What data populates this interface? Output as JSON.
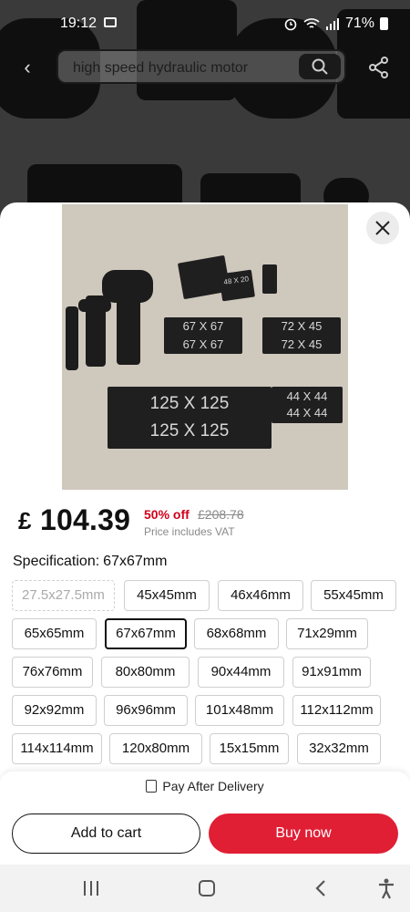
{
  "status_bar": {
    "time": "19:12",
    "battery": "71%"
  },
  "search": {
    "query": "high speed hydraulic motor"
  },
  "product": {
    "currency": "£",
    "price": "104.39",
    "discount": "50% off",
    "original_price": "£208.78",
    "vat_note": "Price includes VAT",
    "image_labels": [
      "67 X 67",
      "67 X 67",
      "72 X 45",
      "72 X 45",
      "125 X 125",
      "125 X 125",
      "44 X 44",
      "44 X 44",
      "48 X 20"
    ]
  },
  "specification": {
    "label": "Specification:",
    "selected": "67x67mm",
    "options": [
      {
        "label": "27.5x27.5mm",
        "state": "disabled"
      },
      {
        "label": "45x45mm",
        "state": "normal"
      },
      {
        "label": "46x46mm",
        "state": "normal"
      },
      {
        "label": "55x45mm",
        "state": "normal"
      },
      {
        "label": "65x65mm",
        "state": "normal"
      },
      {
        "label": "67x67mm",
        "state": "selected"
      },
      {
        "label": "68x68mm",
        "state": "normal"
      },
      {
        "label": "71x29mm",
        "state": "normal"
      },
      {
        "label": "76x76mm",
        "state": "normal"
      },
      {
        "label": "80x80mm",
        "state": "normal"
      },
      {
        "label": "90x44mm",
        "state": "normal"
      },
      {
        "label": "91x91mm",
        "state": "normal"
      },
      {
        "label": "92x92mm",
        "state": "normal"
      },
      {
        "label": "96x96mm",
        "state": "normal"
      },
      {
        "label": "101x48mm",
        "state": "normal"
      },
      {
        "label": "112x112mm",
        "state": "normal"
      },
      {
        "label": "114x114mm",
        "state": "normal"
      },
      {
        "label": "120x80mm",
        "state": "normal"
      },
      {
        "label": "15x15mm",
        "state": "normal"
      },
      {
        "label": "32x32mm",
        "state": "normal"
      }
    ]
  },
  "footer": {
    "pay_after": "Pay After Delivery",
    "add_to_cart": "Add to cart",
    "buy_now": "Buy now"
  },
  "colors": {
    "accent_red": "#e01f35",
    "discount_red": "#d0021b"
  },
  "icons": [
    "message-icon",
    "alarm-icon",
    "wifi-icon",
    "signal-icon",
    "battery-icon",
    "back-arrow-icon",
    "search-icon",
    "share-icon",
    "close-icon",
    "receipt-icon",
    "nav-recents-icon",
    "nav-home-icon",
    "nav-back-icon",
    "accessibility-icon"
  ]
}
